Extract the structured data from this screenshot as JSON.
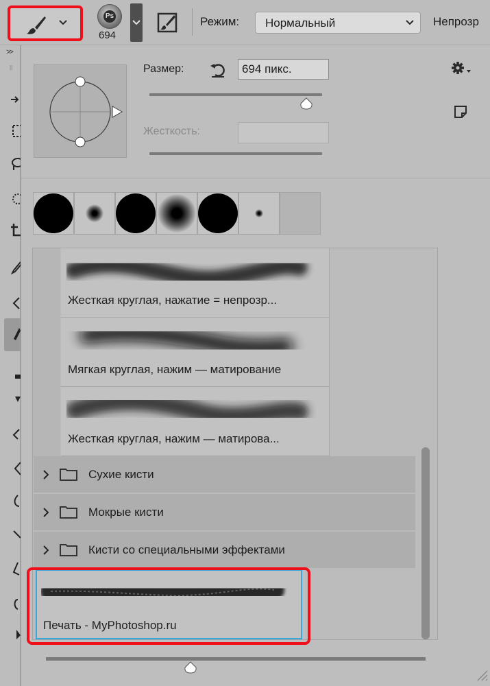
{
  "options_bar": {
    "brush_tool_icon": "brush-icon",
    "preset_size": "694",
    "preset_badge": "Ps",
    "mode_label": "Режим:",
    "mode_value": "Нормальный",
    "opacity_label": "Непрозр"
  },
  "toolbar": {
    "collapse_glyph": ">>",
    "grip_glyph": "||"
  },
  "picker": {
    "size_label": "Размер:",
    "size_value": "694 пикс.",
    "size_slider_fraction": 0.91,
    "hardness_label": "Жесткость:",
    "hardness_value": "",
    "recent_brushes": [
      {
        "kind": "hard",
        "size": 58
      },
      {
        "kind": "soft",
        "size": 26
      },
      {
        "kind": "hard",
        "size": 58
      },
      {
        "kind": "soft",
        "size": 56
      },
      {
        "kind": "hard",
        "size": 58
      },
      {
        "kind": "soft",
        "size": 12
      }
    ],
    "brushes": [
      {
        "name": "Жесткая круглая, нажатие = непрозр..."
      },
      {
        "name": "Мягкая круглая, нажим — матирование"
      },
      {
        "name": "Жесткая круглая, нажим — матирова..."
      }
    ],
    "groups": [
      {
        "label": "Сухие кисти"
      },
      {
        "label": "Мокрые кисти"
      },
      {
        "label": "Кисти со специальными эффектами"
      }
    ],
    "custom_brush": {
      "name": "Печать - MyPhotoshop.ru"
    },
    "bottom_slider_fraction": 0.38
  },
  "colors": {
    "highlight": "#ee0f1b",
    "selection_border": "#3aa6d9"
  }
}
